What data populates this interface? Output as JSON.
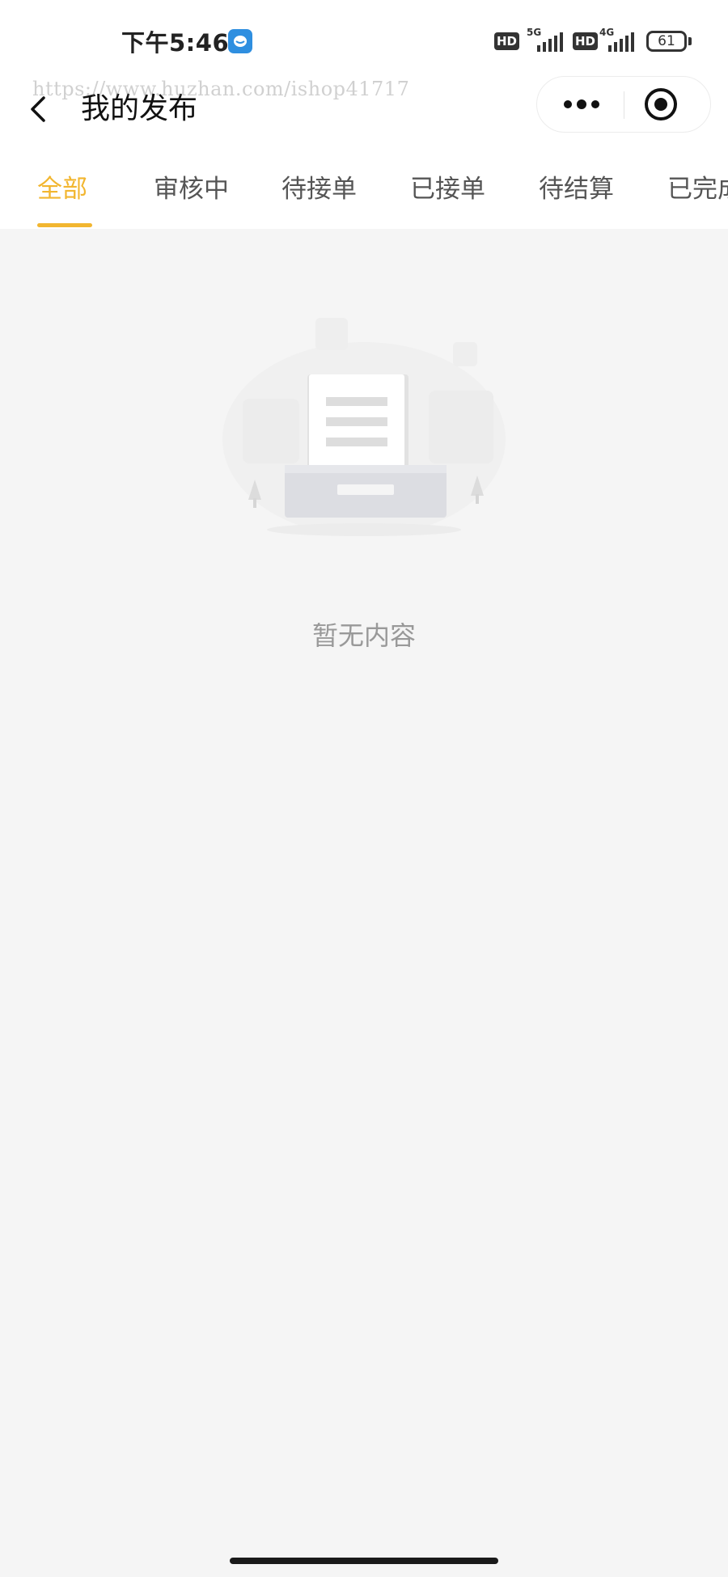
{
  "status_bar": {
    "time": "下午5:46",
    "sim1_hd": "HD",
    "sim1_network": "5G",
    "sim2_hd": "HD",
    "sim2_network": "4G",
    "battery_level": "61"
  },
  "watermark": "https://www.huzhan.com/ishop41717",
  "nav": {
    "title": "我的发布"
  },
  "tabs": [
    {
      "label": "全部",
      "active": true
    },
    {
      "label": "审核中",
      "active": false
    },
    {
      "label": "待接单",
      "active": false
    },
    {
      "label": "已接单",
      "active": false
    },
    {
      "label": "待结算",
      "active": false
    },
    {
      "label": "已完成",
      "active": false
    }
  ],
  "empty_state": {
    "message": "暂无内容",
    "icon": "empty-inbox-illustration"
  },
  "colors": {
    "accent": "#f2b630",
    "background": "#f5f5f5",
    "empty_text": "#999999"
  }
}
